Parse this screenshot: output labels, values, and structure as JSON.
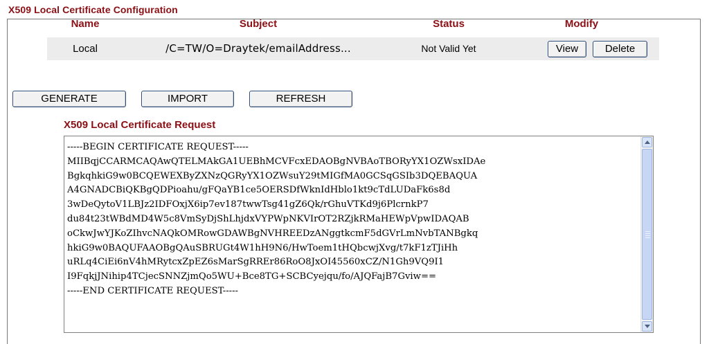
{
  "page": {
    "title": "X509 Local Certificate Configuration"
  },
  "table": {
    "headers": {
      "name": "Name",
      "subject": "Subject",
      "status": "Status",
      "modify": "Modify"
    },
    "rows": [
      {
        "name": "Local",
        "subject": "/C=TW/O=Draytek/emailAddress...",
        "status": "Not Valid Yet",
        "view_label": "View",
        "delete_label": "Delete"
      }
    ]
  },
  "actions": {
    "generate_label": "GENERATE",
    "import_label": "IMPORT",
    "refresh_label": "REFRESH"
  },
  "request": {
    "title": "X509 Local Certificate Request",
    "text": "-----BEGIN CERTIFICATE REQUEST-----\nMIIBqjCCARMCAQAwQTELMAkGA1UEBhMCVFcxEDAOBgNVBAoTBORyYX1OZWsxIDAe\nBgkqhkiG9w0BCQEWEXByZXNzQGRyYX1OZWsuY29tMIGfMA0GCSqGSIb3DQEBAQUA\nA4GNADCBiQKBgQDPioahu/gFQaYB1ce5OERSDfWknIdHblo1kt9cTdLUDaFk6s8d\n3wDeQytoV1LBJz2IDFOxjX6ip7ev187twwTsg41gZ6Qk/rGhuVTKd9j6PlcrnkP7\ndu84t23tWBdMD4W5c8VmSyDjShLhjdxVYPWpNKVIrOT2RZjkRMaHEWpVpwIDAQAB\noCkwJwYJKoZIhvcNAQkOMRowGDAWBgNVHREEDzANggtkcmF5dGVrLmNvbTANBgkq\nhkiG9w0BAQUFAAOBgQAuSBRUGt4W1hH9N6/HwToem1tHQbcwjXvg/t7kF1zTJiHh\nuRLq4CiEi6nV4hMRytcxZpEZ6sMarSgRREr86RoO8JxOI45560xCZ/N1Gh9VQ9I1\nI9FqkjJNihip4TCjecSNNZjmQo5WU+Bce8TG+SCBCyejqu/fo/AJQFajB7Gviw==\n-----END CERTIFICATE REQUEST-----"
  }
}
